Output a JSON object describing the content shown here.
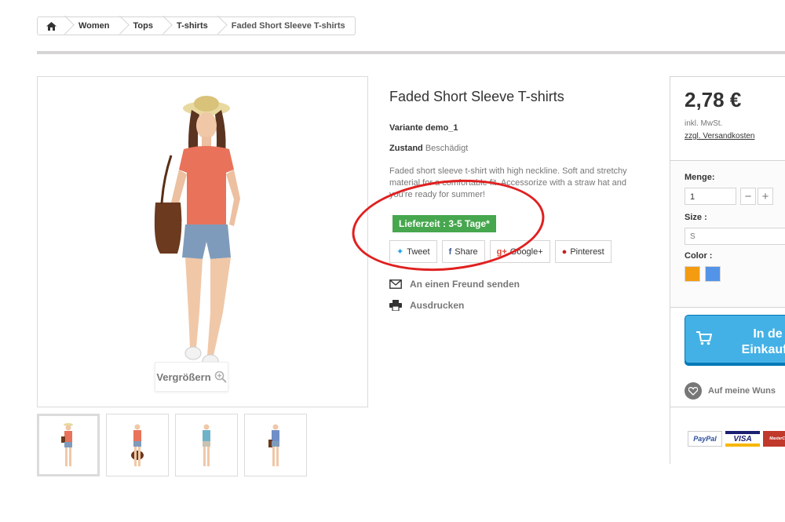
{
  "breadcrumb": {
    "items": [
      "Women",
      "Tops",
      "T-shirts"
    ],
    "current": "Faded Short Sleeve T-shirts"
  },
  "image": {
    "zoom_label": "Vergrößern"
  },
  "product": {
    "title": "Faded Short Sleeve T-shirts",
    "variant": "Variante demo_1",
    "condition_label": "Zustand",
    "condition_value": "Beschädigt",
    "description": "Faded short sleeve t-shirt with high neckline. Soft and stretchy material for a comfortable fit. Accessorize with a straw hat and you're ready for summer!",
    "delivery": "Lieferzeit : 3-5 Tage*"
  },
  "social": {
    "tweet": "Tweet",
    "share": "Share",
    "google": "Google+",
    "pinterest": "Pinterest"
  },
  "links": {
    "send_friend": "An einen Freund senden",
    "print": "Ausdrucken"
  },
  "buybox": {
    "price": "2,78 €",
    "tax": "inkl. MwSt.",
    "shipping": "zzgl. Versandkosten",
    "qty_label": "Menge:",
    "qty_value": "1",
    "size_label": "Size :",
    "size_value": "S",
    "color_label": "Color :",
    "colors": [
      "#f39c11",
      "#5494e8"
    ],
    "cart_line1": "In de",
    "cart_line2": "Einkaufs",
    "wishlist": "Auf meine Wuns",
    "payments": [
      "PayPal",
      "VISA",
      "MasterCard"
    ]
  },
  "accent": {
    "green": "#46a74e",
    "blue": "#43b1e6",
    "annotation": "#e02020"
  }
}
